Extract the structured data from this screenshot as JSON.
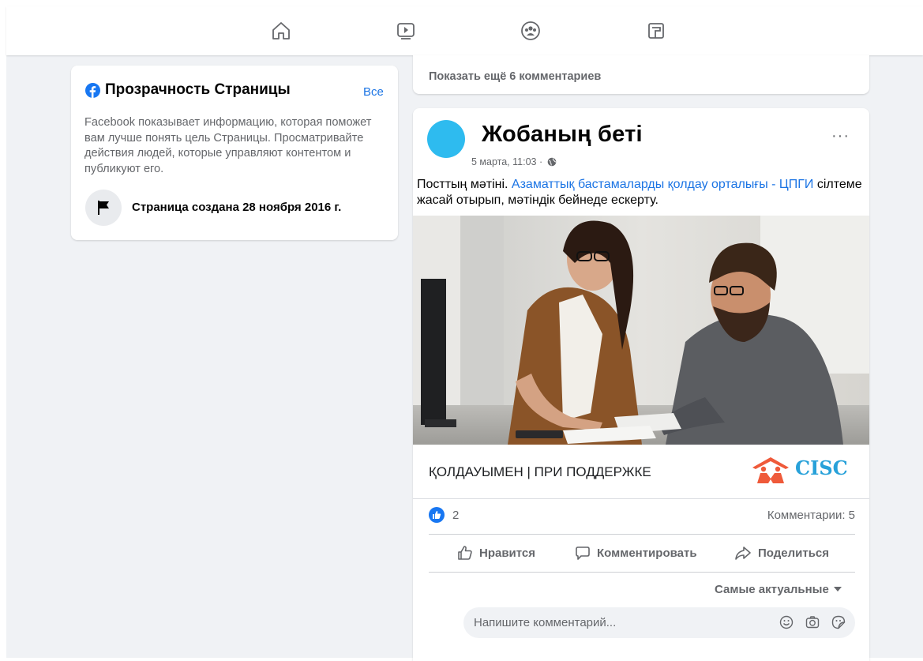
{
  "nav": {
    "icons": [
      "home-icon",
      "watch-icon",
      "groups-icon",
      "gaming-icon"
    ]
  },
  "transparency": {
    "title": "Прозрачность Страницы",
    "see_all": "Все",
    "description": "Facebook показывает информацию, которая поможет вам лучше понять цель Страницы. Просматривайте действия людей, которые управляют контентом и публикуют его.",
    "created": "Страница создана 28 ноября 2016 г."
  },
  "comments_strip": {
    "show_more": "Показать ещё 6 комментариев"
  },
  "post": {
    "author": "Жобаның беті",
    "more": "···",
    "timestamp": "5 марта, 11:03 ·",
    "text_plain": "Посттың мәтіні. ",
    "text_link": "Азаматтық бастамаларды қолдау орталығы - ЦПГИ",
    "text_rest": " сілтеме жасай отырып, мәтіндік бейнеде ескерту.",
    "support_text": "ҚОЛДАУЫМЕН | ПРИ ПОДДЕРЖКЕ",
    "logo_text": "CISC",
    "likes": "2",
    "comments": "Комментарии: 5",
    "actions": {
      "like": "Нравится",
      "comment": "Комментировать",
      "share": "Поделиться"
    },
    "sort_label": "Самые актуальные",
    "comment_placeholder": "Напишите комментарий..."
  },
  "colors": {
    "accent": "#1b74e4",
    "avatar": "#2ebbef",
    "background": "#f0f2f5",
    "logo": "#28a1d9"
  }
}
